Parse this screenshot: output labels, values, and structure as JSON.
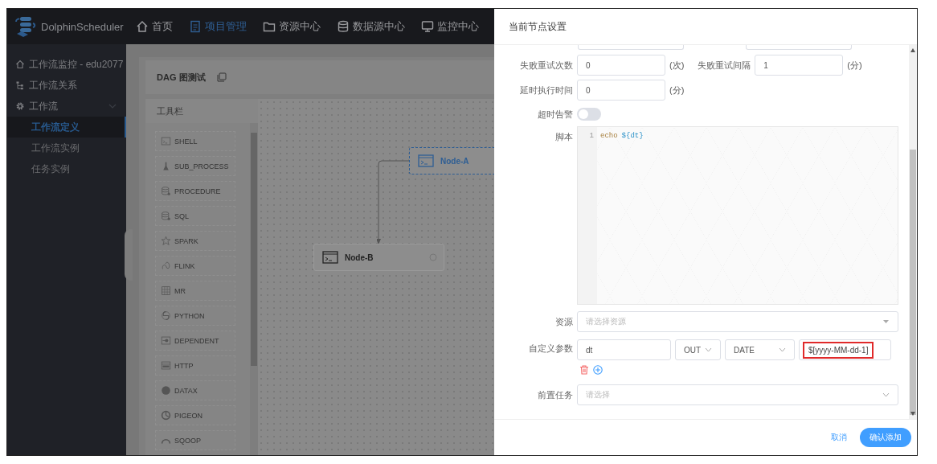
{
  "app": {
    "name": "DolphinScheduler"
  },
  "nav": [
    {
      "label": "首页",
      "selected": false
    },
    {
      "label": "项目管理",
      "selected": true
    },
    {
      "label": "资源中心",
      "selected": false
    },
    {
      "label": "数据源中心",
      "selected": false
    },
    {
      "label": "监控中心",
      "selected": false
    }
  ],
  "sidebar": {
    "items": [
      {
        "label": "工作流监控 - edu2077"
      },
      {
        "label": "工作流关系"
      },
      {
        "label": "工作流",
        "expanded": true,
        "children": [
          {
            "label": "工作流定义",
            "selected": true
          },
          {
            "label": "工作流实例",
            "selected": false
          },
          {
            "label": "任务实例",
            "selected": false
          }
        ]
      }
    ]
  },
  "dag": {
    "title": "DAG 图测试",
    "toolbar_title": "工具栏",
    "tools": [
      {
        "label": "SHELL"
      },
      {
        "label": "SUB_PROCESS"
      },
      {
        "label": "PROCEDURE"
      },
      {
        "label": "SQL"
      },
      {
        "label": "SPARK"
      },
      {
        "label": "FLINK"
      },
      {
        "label": "MR"
      },
      {
        "label": "PYTHON"
      },
      {
        "label": "DEPENDENT"
      },
      {
        "label": "HTTP"
      },
      {
        "label": "DATAX"
      },
      {
        "label": "PIGEON"
      },
      {
        "label": "SQOOP"
      }
    ],
    "nodes": [
      {
        "label": "Node-A",
        "selected": true
      },
      {
        "label": "Node-B",
        "selected": false
      }
    ]
  },
  "drawer": {
    "title": "当前节点设置",
    "retry": {
      "times_label": "失败重试次数",
      "times_value": "0",
      "times_unit": "(次)",
      "interval_label": "失败重试间隔",
      "interval_value": "1",
      "interval_unit": "(分)"
    },
    "delay": {
      "label": "延时执行时间",
      "value": "0",
      "unit": "(分)"
    },
    "timeout_alarm": {
      "label": "超时告警",
      "on": false
    },
    "script": {
      "label": "脚本",
      "lines": [
        {
          "number": "1",
          "tokens": [
            {
              "text": "echo",
              "kind": "keyword"
            },
            {
              "text": "${dt}",
              "kind": "variable"
            }
          ]
        }
      ]
    },
    "resource": {
      "label": "资源",
      "placeholder": "请选择资源"
    },
    "custom_params": {
      "label": "自定义参数",
      "rows": [
        {
          "prop": "dt",
          "direction": "OUT",
          "type": "DATE",
          "value": "$[yyyy-MM-dd-1]",
          "highlighted": true
        }
      ]
    },
    "pre_tasks": {
      "label": "前置任务",
      "placeholder": "请选择"
    },
    "buttons": {
      "cancel": "取消",
      "confirm": "确认添加"
    }
  }
}
